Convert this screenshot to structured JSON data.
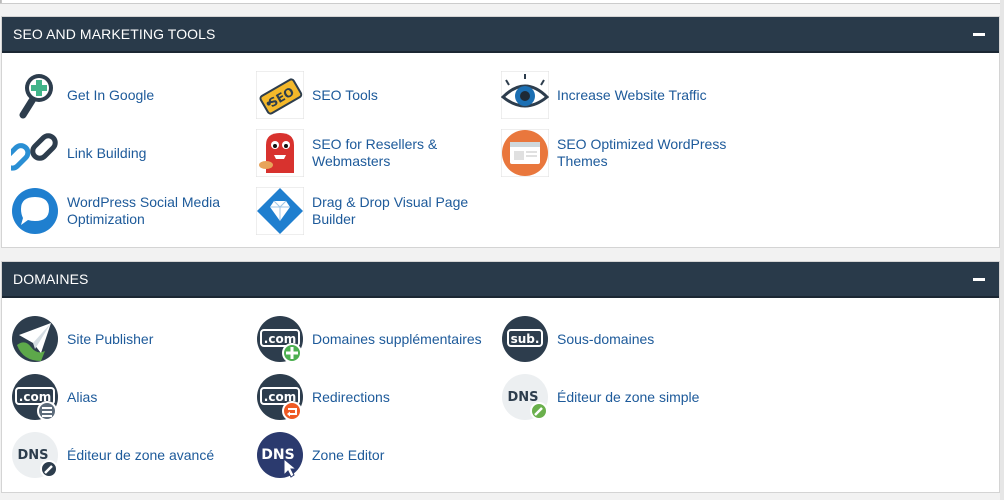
{
  "sections": [
    {
      "title": "SEO AND MARKETING TOOLS",
      "items": [
        {
          "label": "Get In Google",
          "icon": "magnifier-plus-icon"
        },
        {
          "label": "SEO Tools",
          "icon": "seo-tag-icon"
        },
        {
          "label": "Increase Website Traffic",
          "icon": "eye-icon"
        },
        {
          "label": "Link Building",
          "icon": "chain-link-icon"
        },
        {
          "label": "SEO for Resellers & Webmasters",
          "icon": "red-monster-icon"
        },
        {
          "label": "SEO Optimized WordPress Themes",
          "icon": "browser-window-icon"
        },
        {
          "label": "WordPress Social Media Optimization",
          "icon": "speech-bubble-icon"
        },
        {
          "label": "Drag & Drop Visual Page Builder",
          "icon": "diamond-icon"
        }
      ]
    },
    {
      "title": "DOMAINES",
      "items": [
        {
          "label": "Site Publisher",
          "icon": "paper-plane-globe-icon"
        },
        {
          "label": "Domaines supplémentaires",
          "icon": "dotcom-add-icon"
        },
        {
          "label": "Sous-domaines",
          "icon": "sub-domain-icon"
        },
        {
          "label": "Alias",
          "icon": "dotcom-list-icon"
        },
        {
          "label": "Redirections",
          "icon": "dotcom-redirect-icon"
        },
        {
          "label": "Éditeur de zone simple",
          "icon": "dns-edit-green-icon"
        },
        {
          "label": "Éditeur de zone avancé",
          "icon": "dns-edit-dark-icon"
        },
        {
          "label": "Zone Editor",
          "icon": "dns-pointer-icon"
        }
      ]
    }
  ],
  "colors": {
    "header_bg": "#293a4a",
    "link": "#1d5a9a"
  }
}
